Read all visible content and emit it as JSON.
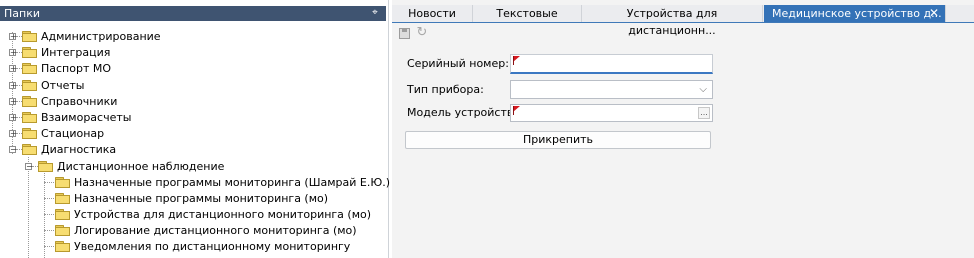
{
  "folders_panel": {
    "title": "Папки",
    "tree": [
      {
        "label": "Администрирование",
        "level": 0,
        "expander": "+"
      },
      {
        "label": "Интеграция",
        "level": 0,
        "expander": "+"
      },
      {
        "label": "Паспорт МО",
        "level": 0,
        "expander": "+"
      },
      {
        "label": "Отчеты",
        "level": 0,
        "expander": "+"
      },
      {
        "label": "Справочники",
        "level": 0,
        "expander": "+"
      },
      {
        "label": "Взаиморасчеты",
        "level": 0,
        "expander": "+"
      },
      {
        "label": "Стационар",
        "level": 0,
        "expander": "+"
      },
      {
        "label": "Диагностика",
        "level": 0,
        "expander": "−"
      },
      {
        "label": "Дистанционное наблюдение",
        "level": 1,
        "expander": "−"
      },
      {
        "label": "Назначенные программы мониторинга (Шамрай Е.Ю.)",
        "level": 2,
        "expander": ""
      },
      {
        "label": "Назначенные программы мониторинга (мо)",
        "level": 2,
        "expander": ""
      },
      {
        "label": "Устройства для дистанционного мониторинга (мо)",
        "level": 2,
        "expander": "",
        "open": true
      },
      {
        "label": "Логирование дистанционного мониторинга (мо)",
        "level": 2,
        "expander": ""
      },
      {
        "label": "Уведомления по дистанционному мониторингу",
        "level": 2,
        "expander": ""
      }
    ]
  },
  "tabs": [
    {
      "label": "Новости",
      "active": false
    },
    {
      "label": "Текстовые",
      "active": false
    },
    {
      "label": "Устройства для дистанционн...",
      "active": false
    },
    {
      "label": "Медицинское устройство д...",
      "active": true
    }
  ],
  "toolbar": {
    "save_icon": "save-icon",
    "refresh_icon": "refresh-icon"
  },
  "form": {
    "serial_label": "Серийный номер:",
    "serial_value": "",
    "device_type_label": "Тип прибора:",
    "device_type_value": "",
    "device_model_label": "Модель устройства:",
    "device_model_value": "",
    "attach_button": "Прикрепить"
  },
  "colors": {
    "panel_header": "#3f5471",
    "active_tab": "#3472b7",
    "required_flag": "#d71920"
  }
}
